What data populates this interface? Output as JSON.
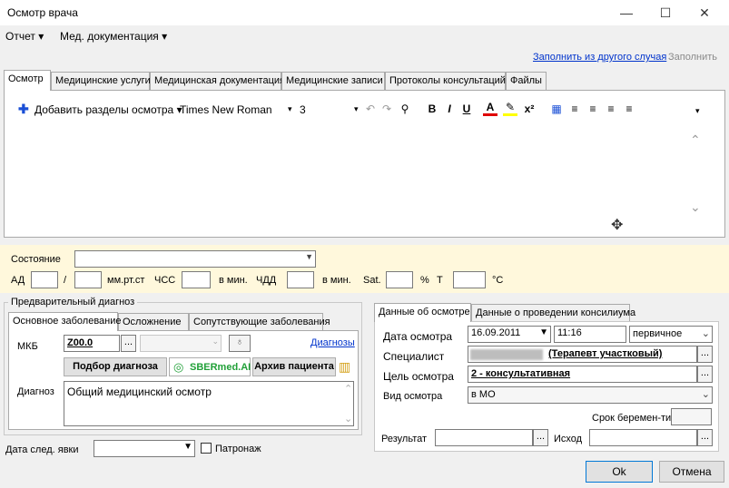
{
  "window": {
    "title": "Осмотр врача",
    "minimize": "—",
    "maximize": "☐",
    "close": "✕"
  },
  "menu": {
    "report": "Отчет ▾",
    "med_docs": "Мед. документация ▾"
  },
  "fill_links": {
    "fill_from_other": "Заполнить из другого случая",
    "fill": "Заполнить"
  },
  "tabs": [
    "Осмотр",
    "Медицинские услуги",
    "Медицинская документация",
    "Медицинские записи",
    "Протоколы консультаций",
    "Файлы"
  ],
  "toolbar": {
    "add_sections": "Добавить разделы осмотра ▾",
    "font_name": "Times New Roman",
    "font_size": "3"
  },
  "vitals": {
    "state_label": "Состояние",
    "ad_label": "АД",
    "slash": "/",
    "mmhg": "мм.рт.ст",
    "chss_label": "ЧСС",
    "per_min1": "в мин.",
    "chdd_label": "ЧДД",
    "per_min2": "в мин.",
    "sat_label": "Sat.",
    "percent": "%",
    "t_label": "T",
    "celsius": "°C"
  },
  "prelim": {
    "group_title": "Предварительный диагноз",
    "tabs": [
      "Основное заболевание",
      "Осложнение",
      "Сопутствующие заболевания"
    ],
    "mkb_label": "МКБ",
    "mkb_value": "Z00.0",
    "diagnoses_link": "Диагнозы",
    "pick_button": "Подбор диагноза",
    "sber_label": "SBERmed.AI",
    "archive_button": "Архив пациента",
    "diagnosis_label": "Диагноз",
    "diagnosis_value": "Общий медицинский осмотр"
  },
  "next_visit": {
    "label": "Дата след. явки",
    "patronage": "Патронаж"
  },
  "exam": {
    "tabs": [
      "Данные об осмотре",
      "Данные о проведении консилиума"
    ],
    "date_label": "Дата осмотра",
    "date_value": "16.09.2011",
    "time_value": "11:16",
    "type_value": "первичное",
    "specialist_label": "Специалист",
    "specialist_value": "(Терапевт участковый)",
    "goal_label": "Цель осмотра",
    "goal_value": "2 - консультативная",
    "kind_label": "Вид осмотра",
    "kind_value": "в МО",
    "pregnancy_label": "Срок беремен-ти",
    "result_label": "Результат",
    "outcome_label": "Исход"
  },
  "buttons": {
    "ok": "Ok",
    "cancel": "Отмена"
  }
}
